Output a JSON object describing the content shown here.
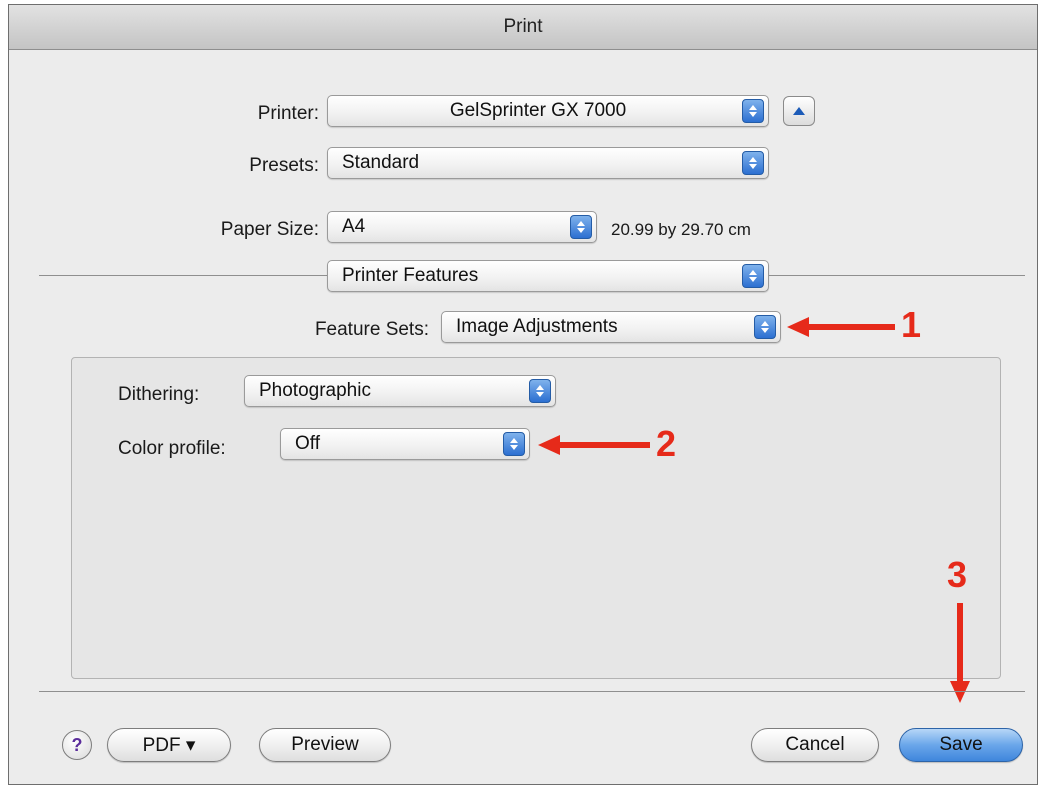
{
  "window": {
    "title": "Print"
  },
  "printer": {
    "label": "Printer:",
    "value": "GelSprinter GX 7000"
  },
  "presets": {
    "label": "Presets:",
    "value": "Standard"
  },
  "paper_size": {
    "label": "Paper Size:",
    "value": "A4",
    "dimensions": "20.99 by 29.70 cm"
  },
  "section": {
    "value": "Printer Features"
  },
  "feature_sets": {
    "label": "Feature Sets:",
    "value": "Image Adjustments"
  },
  "dithering": {
    "label": "Dithering:",
    "value": "Photographic"
  },
  "color_profile": {
    "label": "Color profile:",
    "value": "Off"
  },
  "annotations": {
    "step1": "1",
    "step2": "2",
    "step3": "3"
  },
  "buttons": {
    "help": "?",
    "pdf": "PDF ▾",
    "preview": "Preview",
    "cancel": "Cancel",
    "save": "Save"
  },
  "colors": {
    "annotation": "#e62a1a",
    "accent": "#3f86dc"
  }
}
